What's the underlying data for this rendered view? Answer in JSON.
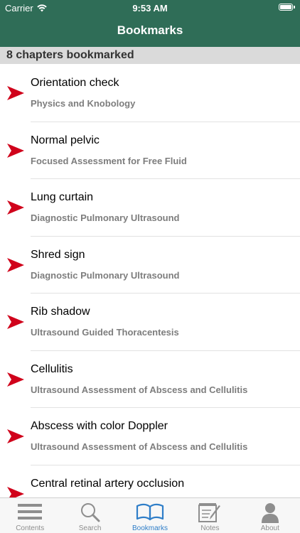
{
  "status_bar": {
    "carrier": "Carrier",
    "time": "9:53 AM"
  },
  "header": {
    "title": "Bookmarks"
  },
  "section": {
    "label": "8 chapters bookmarked"
  },
  "bookmarks": [
    {
      "title": "Orientation check",
      "chapter": "Physics and Knobology"
    },
    {
      "title": "Normal pelvic",
      "chapter": "Focused Assessment for Free Fluid"
    },
    {
      "title": "Lung curtain",
      "chapter": "Diagnostic Pulmonary Ultrasound"
    },
    {
      "title": "Shred sign",
      "chapter": "Diagnostic Pulmonary Ultrasound"
    },
    {
      "title": "Rib shadow",
      "chapter": "Ultrasound Guided Thoracentesis"
    },
    {
      "title": "Cellulitis",
      "chapter": "Ultrasound Assessment of Abscess and Cellulitis"
    },
    {
      "title": "Abscess with color Doppler",
      "chapter": "Ultrasound Assessment of Abscess and Cellulitis"
    },
    {
      "title": "Central retinal artery occlusion",
      "chapter": ""
    }
  ],
  "tabs": [
    {
      "label": "Contents",
      "icon": "list-icon"
    },
    {
      "label": "Search",
      "icon": "search-icon"
    },
    {
      "label": "Bookmarks",
      "icon": "book-icon"
    },
    {
      "label": "Notes",
      "icon": "notepad-icon"
    },
    {
      "label": "About",
      "icon": "person-icon"
    }
  ],
  "colors": {
    "header": "#2f6d57",
    "active_tab": "#2f7ec8",
    "inactive_tab": "#8e8e8e",
    "arrow": "#d0021b"
  }
}
